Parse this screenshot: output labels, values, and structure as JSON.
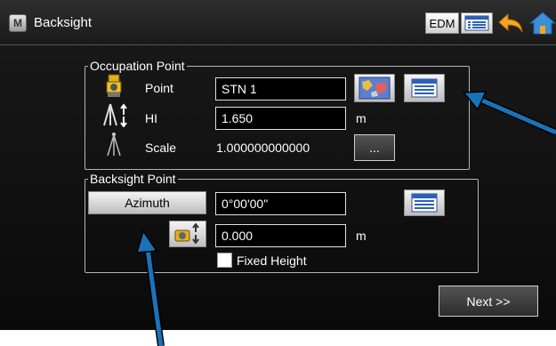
{
  "titlebar": {
    "title": "Backsight",
    "app_icon_label": "M",
    "edm_label": "EDM"
  },
  "occupation": {
    "legend": "Occupation Point",
    "point_label": "Point",
    "point_value": "STN 1",
    "hi_label": "HI",
    "hi_value": "1.650",
    "hi_unit": "m",
    "scale_label": "Scale",
    "scale_value": "1.000000000000",
    "scale_button_label": "..."
  },
  "backsight": {
    "legend": "Backsight Point",
    "azimuth_button_label": "Azimuth",
    "azimuth_value": "0°00'00\"",
    "height_value": "0.000",
    "height_unit": "m",
    "fixed_height_label": "Fixed Height",
    "fixed_height_checked": false
  },
  "footer": {
    "next_label": "Next >>"
  },
  "colors": {
    "background": "#000000",
    "annotation_arrow": "#1a73b8",
    "border": "#b5b5b5"
  }
}
